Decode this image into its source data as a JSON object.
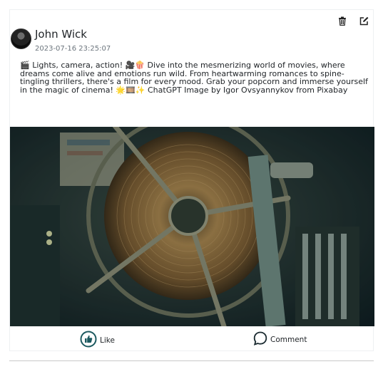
{
  "post": {
    "author": "John Wick",
    "timestamp": "2023-07-16 23:25:07",
    "content": "🎬 Lights, camera, action! 🎥🍿 Dive into the mesmerizing world of movies, where dreams come alive and emotions run wild. From heartwarming romances to spine-tingling thrillers, there's a film for every mood. Grab your popcorn and immerse yourself in the magic of cinema! 🌟🎞️✨ ChatGPT Image by Igor Ovsyannykov from Pixabay",
    "image_subject": "vintage film reel",
    "actions": {
      "delete_icon": "trash-icon",
      "edit_icon": "edit-icon"
    }
  },
  "footer": {
    "like_label": "Like",
    "like_icon": "thumbs-up-icon",
    "comment_label": "Comment",
    "comment_icon": "comment-bubble-icon"
  },
  "colors": {
    "accent": "#1d5a60"
  }
}
